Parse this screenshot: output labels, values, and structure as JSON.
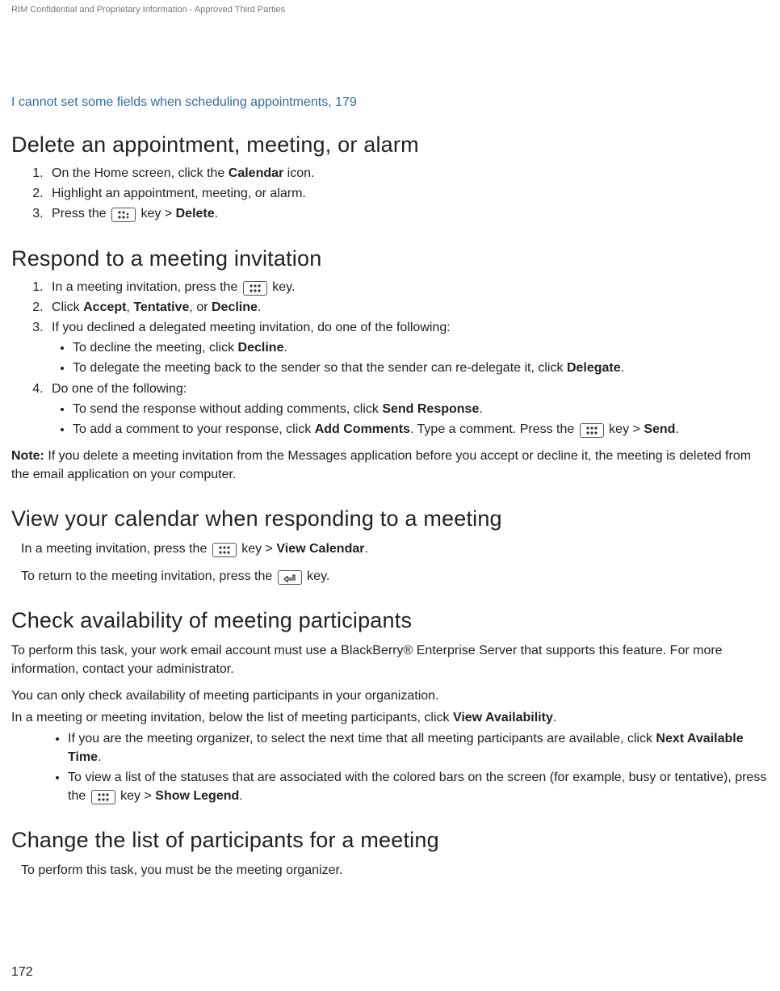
{
  "header": {
    "confidential": "RIM Confidential and Proprietary Information - Approved Third Parties"
  },
  "link": {
    "text": "I cannot set some fields when scheduling appointments, 179"
  },
  "sections": {
    "delete": {
      "title": "Delete an appointment, meeting, or alarm",
      "step1_a": "On the Home screen, click the ",
      "step1_b": "Calendar",
      "step1_c": " icon.",
      "step2": "Highlight an appointment, meeting, or alarm.",
      "step3_a": "Press the ",
      "step3_b": " key > ",
      "step3_c": "Delete",
      "step3_d": "."
    },
    "respond": {
      "title": "Respond to a meeting invitation",
      "step1_a": "In a meeting invitation, press the ",
      "step1_b": " key.",
      "step2_a": "Click ",
      "step2_b": "Accept",
      "step2_c": ", ",
      "step2_d": "Tentative",
      "step2_e": ", or ",
      "step2_f": "Decline",
      "step2_g": ".",
      "step3": "If you declined a delegated meeting invitation, do one of the following:",
      "step3b1_a": "To decline the meeting, click ",
      "step3b1_b": "Decline",
      "step3b1_c": ".",
      "step3b2_a": "To delegate the meeting back to the sender so that the sender can re-delegate it, click ",
      "step3b2_b": "Delegate",
      "step3b2_c": ".",
      "step4": "Do one of the following:",
      "step4b1_a": "To send the response without adding comments, click ",
      "step4b1_b": "Send Response",
      "step4b1_c": ".",
      "step4b2_a": "To add a comment to your response, click ",
      "step4b2_b": "Add Comments",
      "step4b2_c": ". Type a comment. Press the ",
      "step4b2_d": " key > ",
      "step4b2_e": "Send",
      "step4b2_f": ".",
      "note_a": "Note:",
      "note_b": " If you delete a meeting invitation from the Messages application before you accept or decline it, the meeting is deleted from the email application on your computer."
    },
    "viewcal": {
      "title": "View your calendar when responding to a meeting",
      "p1_a": "In a meeting invitation, press the ",
      "p1_b": " key > ",
      "p1_c": "View Calendar",
      "p1_d": ".",
      "p2_a": "To return to the meeting invitation, press the ",
      "p2_b": " key."
    },
    "checkavail": {
      "title": "Check availability of meeting participants",
      "p1": "To perform this task, your work email account must use a BlackBerry® Enterprise Server that supports this feature. For more information, contact your administrator.",
      "p2": "You can only check availability of meeting participants in your organization.",
      "p3_a": "In a meeting or meeting invitation, below the list of meeting participants, click ",
      "p3_b": "View Availability",
      "p3_c": ".",
      "b1_a": "If you are the meeting organizer, to select the next time that all meeting participants are available, click ",
      "b1_b": "Next Available Time",
      "b1_c": ".",
      "b2_a": "To view a list of the statuses that are associated with the colored bars on the screen (for example, busy or tentative), press the ",
      "b2_b": " key > ",
      "b2_c": "Show Legend",
      "b2_d": "."
    },
    "changelist": {
      "title": "Change the list of participants for a meeting",
      "p1": "To perform this task, you must be the meeting organizer."
    }
  },
  "footer": {
    "page": "172"
  }
}
